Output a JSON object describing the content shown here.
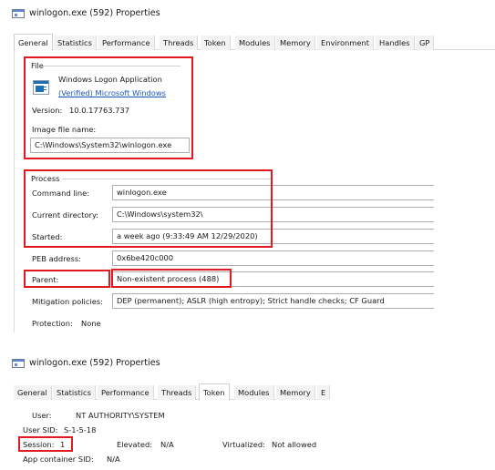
{
  "window1": {
    "title": "winlogon.exe (592) Properties",
    "tabs": [
      {
        "label": "General"
      },
      {
        "label": "Statistics"
      },
      {
        "label": "Performance"
      },
      {
        "label": "Threads"
      },
      {
        "label": "Token"
      },
      {
        "label": "Modules"
      },
      {
        "label": "Memory"
      },
      {
        "label": "Environment"
      },
      {
        "label": "Handles"
      },
      {
        "label": "GP"
      }
    ],
    "file": {
      "group_label": "File",
      "description": "Windows Logon Application",
      "verified": "(Verified) Microsoft Windows",
      "version_label": "Version:",
      "version_value": "10.0.17763.737",
      "image_label": "Image file name:",
      "image_value": "C:\\Windows\\System32\\winlogon.exe"
    },
    "process": {
      "group_label": "Process",
      "cmd_label": "Command line:",
      "cmd_value": "winlogon.exe",
      "dir_label": "Current directory:",
      "dir_value": "C:\\Windows\\system32\\",
      "started_label": "Started:",
      "started_value": "a week ago (9:33:49 AM 12/29/2020)",
      "peb_label": "PEB address:",
      "peb_value": "0x6be420c000",
      "parent_label": "Parent:",
      "parent_value": "Non-existent process (488)",
      "mitigation_label": "Mitigation policies:",
      "mitigation_value": "DEP (permanent); ASLR (high entropy); Strict handle checks; CF Guard",
      "protection_label": "Protection:",
      "protection_value": "None"
    }
  },
  "window2": {
    "title": "winlogon.exe (592) Properties",
    "tabs": [
      {
        "label": "General"
      },
      {
        "label": "Statistics"
      },
      {
        "label": "Performance"
      },
      {
        "label": "Threads"
      },
      {
        "label": "Token"
      },
      {
        "label": "Modules"
      },
      {
        "label": "Memory"
      },
      {
        "label": "E"
      }
    ],
    "token": {
      "user_label": "User:",
      "user_value": "NT AUTHORITY\\SYSTEM",
      "sid_label": "User SID:",
      "sid_value": "S-1-5-18",
      "session_label": "Session:",
      "session_value": "1",
      "elevated_label": "Elevated:",
      "elevated_value": "N/A",
      "virtualized_label": "Virtualized:",
      "virtualized_value": "Not allowed",
      "appcontainer_label": "App container SID:",
      "appcontainer_value": "N/A"
    }
  },
  "colors": {
    "highlight": "#e2191f",
    "link": "#1a56b8"
  }
}
